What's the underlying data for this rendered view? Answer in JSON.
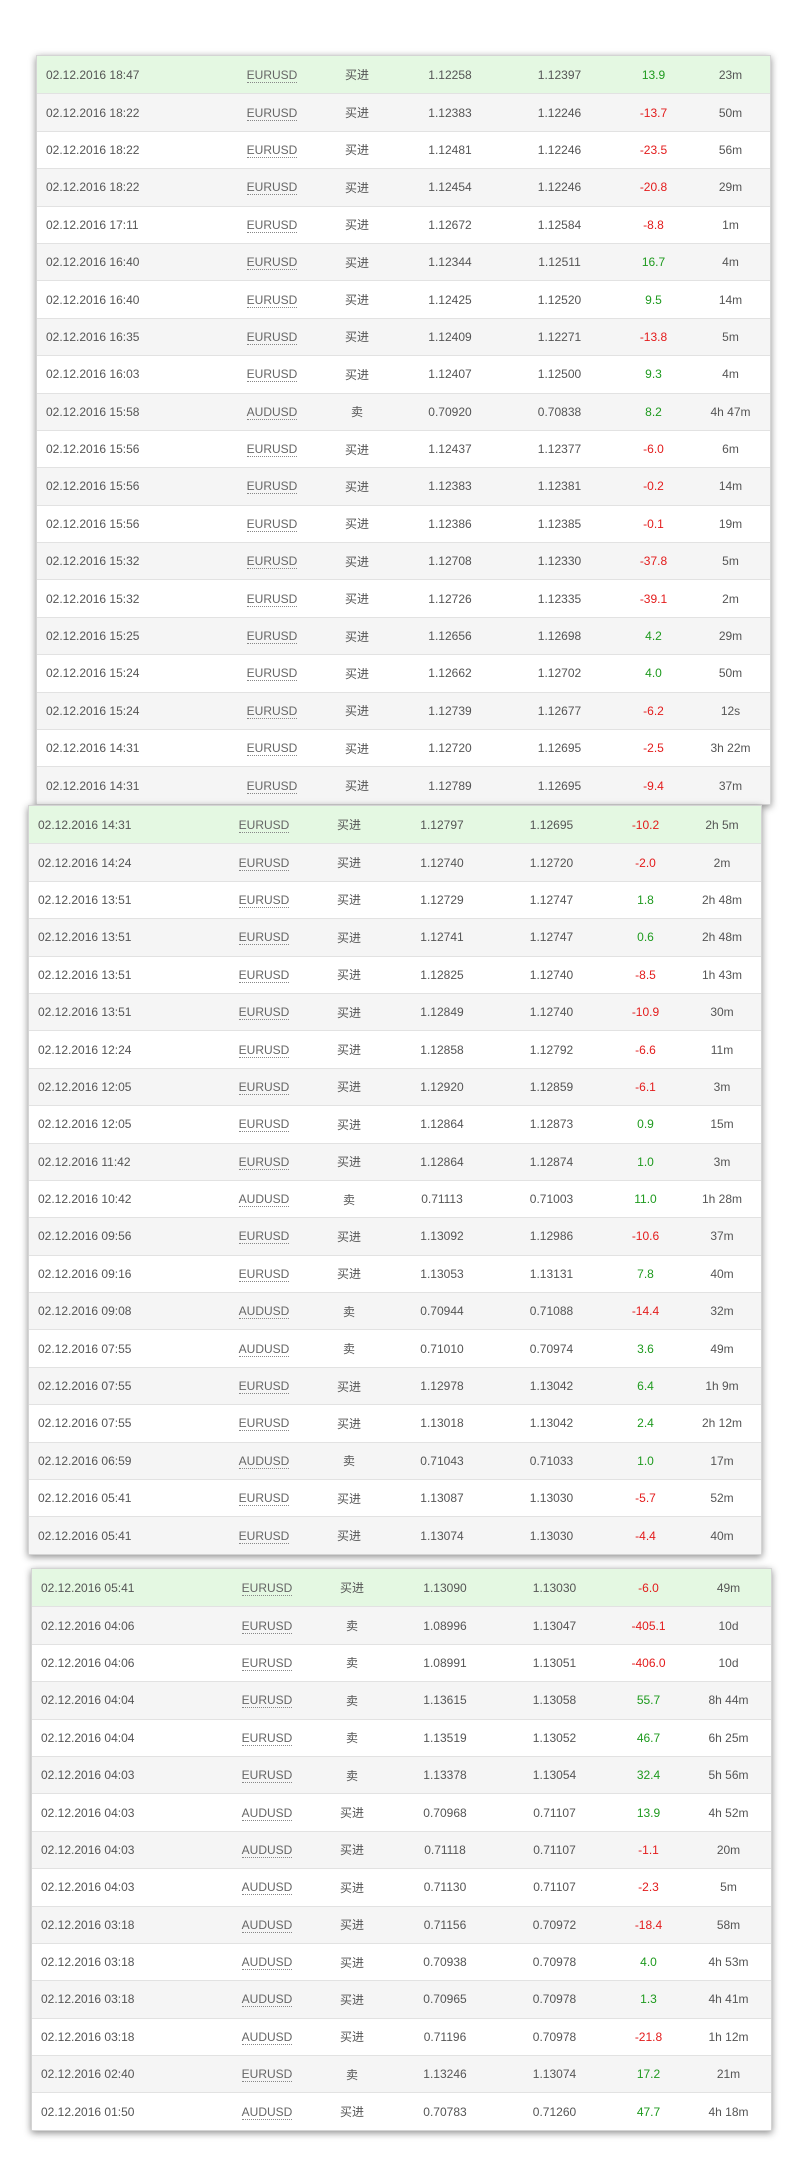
{
  "colors": {
    "positive": "#1e9a1e",
    "negative": "#e31b1b",
    "highlight_row": "#e4f8e2",
    "stripe_row": "#f5f5f5"
  },
  "panels": [
    {
      "rows": [
        {
          "time": "02.12.2016 18:47",
          "symbol": "EURUSD",
          "type": "买进",
          "open": "1.12258",
          "close": "1.12397",
          "pips": "13.9",
          "duration": "23m"
        },
        {
          "time": "02.12.2016 18:22",
          "symbol": "EURUSD",
          "type": "买进",
          "open": "1.12383",
          "close": "1.12246",
          "pips": "-13.7",
          "duration": "50m"
        },
        {
          "time": "02.12.2016 18:22",
          "symbol": "EURUSD",
          "type": "买进",
          "open": "1.12481",
          "close": "1.12246",
          "pips": "-23.5",
          "duration": "56m"
        },
        {
          "time": "02.12.2016 18:22",
          "symbol": "EURUSD",
          "type": "买进",
          "open": "1.12454",
          "close": "1.12246",
          "pips": "-20.8",
          "duration": "29m"
        },
        {
          "time": "02.12.2016 17:11",
          "symbol": "EURUSD",
          "type": "买进",
          "open": "1.12672",
          "close": "1.12584",
          "pips": "-8.8",
          "duration": "1m"
        },
        {
          "time": "02.12.2016 16:40",
          "symbol": "EURUSD",
          "type": "买进",
          "open": "1.12344",
          "close": "1.12511",
          "pips": "16.7",
          "duration": "4m"
        },
        {
          "time": "02.12.2016 16:40",
          "symbol": "EURUSD",
          "type": "买进",
          "open": "1.12425",
          "close": "1.12520",
          "pips": "9.5",
          "duration": "14m"
        },
        {
          "time": "02.12.2016 16:35",
          "symbol": "EURUSD",
          "type": "买进",
          "open": "1.12409",
          "close": "1.12271",
          "pips": "-13.8",
          "duration": "5m"
        },
        {
          "time": "02.12.2016 16:03",
          "symbol": "EURUSD",
          "type": "买进",
          "open": "1.12407",
          "close": "1.12500",
          "pips": "9.3",
          "duration": "4m"
        },
        {
          "time": "02.12.2016 15:58",
          "symbol": "AUDUSD",
          "type": "卖",
          "open": "0.70920",
          "close": "0.70838",
          "pips": "8.2",
          "duration": "4h 47m"
        },
        {
          "time": "02.12.2016 15:56",
          "symbol": "EURUSD",
          "type": "买进",
          "open": "1.12437",
          "close": "1.12377",
          "pips": "-6.0",
          "duration": "6m"
        },
        {
          "time": "02.12.2016 15:56",
          "symbol": "EURUSD",
          "type": "买进",
          "open": "1.12383",
          "close": "1.12381",
          "pips": "-0.2",
          "duration": "14m"
        },
        {
          "time": "02.12.2016 15:56",
          "symbol": "EURUSD",
          "type": "买进",
          "open": "1.12386",
          "close": "1.12385",
          "pips": "-0.1",
          "duration": "19m"
        },
        {
          "time": "02.12.2016 15:32",
          "symbol": "EURUSD",
          "type": "买进",
          "open": "1.12708",
          "close": "1.12330",
          "pips": "-37.8",
          "duration": "5m"
        },
        {
          "time": "02.12.2016 15:32",
          "symbol": "EURUSD",
          "type": "买进",
          "open": "1.12726",
          "close": "1.12335",
          "pips": "-39.1",
          "duration": "2m"
        },
        {
          "time": "02.12.2016 15:25",
          "symbol": "EURUSD",
          "type": "买进",
          "open": "1.12656",
          "close": "1.12698",
          "pips": "4.2",
          "duration": "29m"
        },
        {
          "time": "02.12.2016 15:24",
          "symbol": "EURUSD",
          "type": "买进",
          "open": "1.12662",
          "close": "1.12702",
          "pips": "4.0",
          "duration": "50m"
        },
        {
          "time": "02.12.2016 15:24",
          "symbol": "EURUSD",
          "type": "买进",
          "open": "1.12739",
          "close": "1.12677",
          "pips": "-6.2",
          "duration": "12s"
        },
        {
          "time": "02.12.2016 14:31",
          "symbol": "EURUSD",
          "type": "买进",
          "open": "1.12720",
          "close": "1.12695",
          "pips": "-2.5",
          "duration": "3h 22m"
        },
        {
          "time": "02.12.2016 14:31",
          "symbol": "EURUSD",
          "type": "买进",
          "open": "1.12789",
          "close": "1.12695",
          "pips": "-9.4",
          "duration": "37m"
        }
      ]
    },
    {
      "rows": [
        {
          "time": "02.12.2016 14:31",
          "symbol": "EURUSD",
          "type": "买进",
          "open": "1.12797",
          "close": "1.12695",
          "pips": "-10.2",
          "duration": "2h 5m"
        },
        {
          "time": "02.12.2016 14:24",
          "symbol": "EURUSD",
          "type": "买进",
          "open": "1.12740",
          "close": "1.12720",
          "pips": "-2.0",
          "duration": "2m"
        },
        {
          "time": "02.12.2016 13:51",
          "symbol": "EURUSD",
          "type": "买进",
          "open": "1.12729",
          "close": "1.12747",
          "pips": "1.8",
          "duration": "2h 48m"
        },
        {
          "time": "02.12.2016 13:51",
          "symbol": "EURUSD",
          "type": "买进",
          "open": "1.12741",
          "close": "1.12747",
          "pips": "0.6",
          "duration": "2h 48m"
        },
        {
          "time": "02.12.2016 13:51",
          "symbol": "EURUSD",
          "type": "买进",
          "open": "1.12825",
          "close": "1.12740",
          "pips": "-8.5",
          "duration": "1h 43m"
        },
        {
          "time": "02.12.2016 13:51",
          "symbol": "EURUSD",
          "type": "买进",
          "open": "1.12849",
          "close": "1.12740",
          "pips": "-10.9",
          "duration": "30m"
        },
        {
          "time": "02.12.2016 12:24",
          "symbol": "EURUSD",
          "type": "买进",
          "open": "1.12858",
          "close": "1.12792",
          "pips": "-6.6",
          "duration": "11m"
        },
        {
          "time": "02.12.2016 12:05",
          "symbol": "EURUSD",
          "type": "买进",
          "open": "1.12920",
          "close": "1.12859",
          "pips": "-6.1",
          "duration": "3m"
        },
        {
          "time": "02.12.2016 12:05",
          "symbol": "EURUSD",
          "type": "买进",
          "open": "1.12864",
          "close": "1.12873",
          "pips": "0.9",
          "duration": "15m"
        },
        {
          "time": "02.12.2016 11:42",
          "symbol": "EURUSD",
          "type": "买进",
          "open": "1.12864",
          "close": "1.12874",
          "pips": "1.0",
          "duration": "3m"
        },
        {
          "time": "02.12.2016 10:42",
          "symbol": "AUDUSD",
          "type": "卖",
          "open": "0.71113",
          "close": "0.71003",
          "pips": "11.0",
          "duration": "1h 28m"
        },
        {
          "time": "02.12.2016 09:56",
          "symbol": "EURUSD",
          "type": "买进",
          "open": "1.13092",
          "close": "1.12986",
          "pips": "-10.6",
          "duration": "37m"
        },
        {
          "time": "02.12.2016 09:16",
          "symbol": "EURUSD",
          "type": "买进",
          "open": "1.13053",
          "close": "1.13131",
          "pips": "7.8",
          "duration": "40m"
        },
        {
          "time": "02.12.2016 09:08",
          "symbol": "AUDUSD",
          "type": "卖",
          "open": "0.70944",
          "close": "0.71088",
          "pips": "-14.4",
          "duration": "32m"
        },
        {
          "time": "02.12.2016 07:55",
          "symbol": "AUDUSD",
          "type": "卖",
          "open": "0.71010",
          "close": "0.70974",
          "pips": "3.6",
          "duration": "49m"
        },
        {
          "time": "02.12.2016 07:55",
          "symbol": "EURUSD",
          "type": "买进",
          "open": "1.12978",
          "close": "1.13042",
          "pips": "6.4",
          "duration": "1h 9m"
        },
        {
          "time": "02.12.2016 07:55",
          "symbol": "EURUSD",
          "type": "买进",
          "open": "1.13018",
          "close": "1.13042",
          "pips": "2.4",
          "duration": "2h 12m"
        },
        {
          "time": "02.12.2016 06:59",
          "symbol": "AUDUSD",
          "type": "卖",
          "open": "0.71043",
          "close": "0.71033",
          "pips": "1.0",
          "duration": "17m"
        },
        {
          "time": "02.12.2016 05:41",
          "symbol": "EURUSD",
          "type": "买进",
          "open": "1.13087",
          "close": "1.13030",
          "pips": "-5.7",
          "duration": "52m"
        },
        {
          "time": "02.12.2016 05:41",
          "symbol": "EURUSD",
          "type": "买进",
          "open": "1.13074",
          "close": "1.13030",
          "pips": "-4.4",
          "duration": "40m"
        }
      ]
    },
    {
      "rows": [
        {
          "time": "02.12.2016 05:41",
          "symbol": "EURUSD",
          "type": "买进",
          "open": "1.13090",
          "close": "1.13030",
          "pips": "-6.0",
          "duration": "49m"
        },
        {
          "time": "02.12.2016 04:06",
          "symbol": "EURUSD",
          "type": "卖",
          "open": "1.08996",
          "close": "1.13047",
          "pips": "-405.1",
          "duration": "10d"
        },
        {
          "time": "02.12.2016 04:06",
          "symbol": "EURUSD",
          "type": "卖",
          "open": "1.08991",
          "close": "1.13051",
          "pips": "-406.0",
          "duration": "10d"
        },
        {
          "time": "02.12.2016 04:04",
          "symbol": "EURUSD",
          "type": "卖",
          "open": "1.13615",
          "close": "1.13058",
          "pips": "55.7",
          "duration": "8h 44m"
        },
        {
          "time": "02.12.2016 04:04",
          "symbol": "EURUSD",
          "type": "卖",
          "open": "1.13519",
          "close": "1.13052",
          "pips": "46.7",
          "duration": "6h 25m"
        },
        {
          "time": "02.12.2016 04:03",
          "symbol": "EURUSD",
          "type": "卖",
          "open": "1.13378",
          "close": "1.13054",
          "pips": "32.4",
          "duration": "5h 56m"
        },
        {
          "time": "02.12.2016 04:03",
          "symbol": "AUDUSD",
          "type": "买进",
          "open": "0.70968",
          "close": "0.71107",
          "pips": "13.9",
          "duration": "4h 52m"
        },
        {
          "time": "02.12.2016 04:03",
          "symbol": "AUDUSD",
          "type": "买进",
          "open": "0.71118",
          "close": "0.71107",
          "pips": "-1.1",
          "duration": "20m"
        },
        {
          "time": "02.12.2016 04:03",
          "symbol": "AUDUSD",
          "type": "买进",
          "open": "0.71130",
          "close": "0.71107",
          "pips": "-2.3",
          "duration": "5m"
        },
        {
          "time": "02.12.2016 03:18",
          "symbol": "AUDUSD",
          "type": "买进",
          "open": "0.71156",
          "close": "0.70972",
          "pips": "-18.4",
          "duration": "58m"
        },
        {
          "time": "02.12.2016 03:18",
          "symbol": "AUDUSD",
          "type": "买进",
          "open": "0.70938",
          "close": "0.70978",
          "pips": "4.0",
          "duration": "4h 53m"
        },
        {
          "time": "02.12.2016 03:18",
          "symbol": "AUDUSD",
          "type": "买进",
          "open": "0.70965",
          "close": "0.70978",
          "pips": "1.3",
          "duration": "4h 41m"
        },
        {
          "time": "02.12.2016 03:18",
          "symbol": "AUDUSD",
          "type": "买进",
          "open": "0.71196",
          "close": "0.70978",
          "pips": "-21.8",
          "duration": "1h 12m"
        },
        {
          "time": "02.12.2016 02:40",
          "symbol": "EURUSD",
          "type": "卖",
          "open": "1.13246",
          "close": "1.13074",
          "pips": "17.2",
          "duration": "21m"
        },
        {
          "time": "02.12.2016 01:50",
          "symbol": "AUDUSD",
          "type": "买进",
          "open": "0.70783",
          "close": "0.71260",
          "pips": "47.7",
          "duration": "4h 18m"
        }
      ]
    }
  ]
}
